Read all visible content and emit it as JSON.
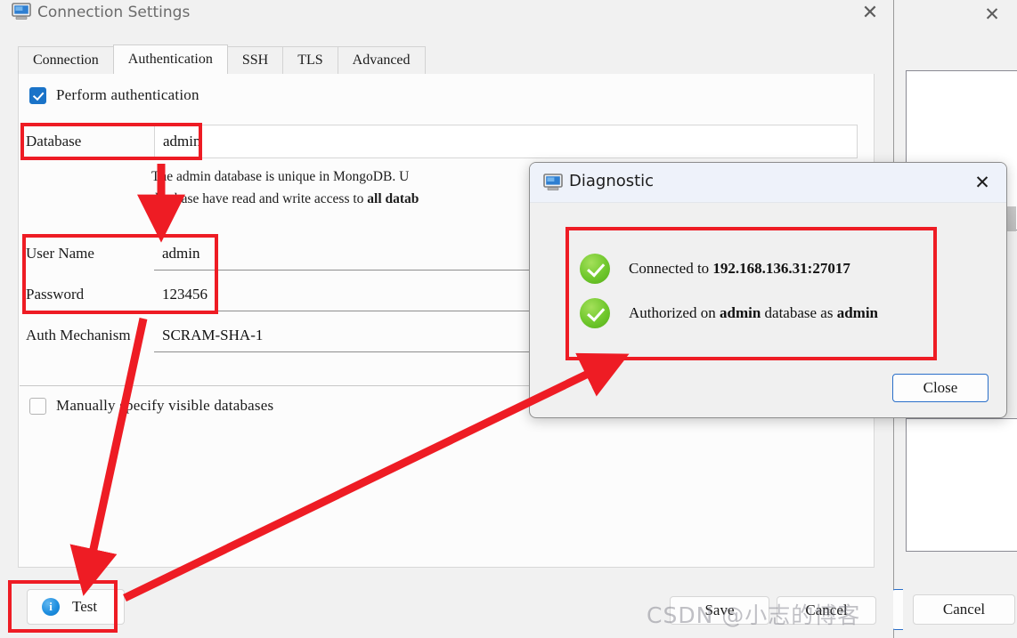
{
  "connection_window": {
    "title": "Connection Settings",
    "title_icon": "monitor-icon",
    "close_label": "✕",
    "tabs": [
      {
        "label": "Connection",
        "active": false
      },
      {
        "label": "Authentication",
        "active": true
      },
      {
        "label": "SSH",
        "active": false
      },
      {
        "label": "TLS",
        "active": false
      },
      {
        "label": "Advanced",
        "active": false
      }
    ],
    "perform_authentication": {
      "label": "Perform authentication",
      "checked": true
    },
    "fields": [
      {
        "label": "Database",
        "value": "admin"
      },
      {
        "label": "User Name",
        "value": "admin"
      },
      {
        "label": "Password",
        "value": "123456"
      },
      {
        "label": "Auth Mechanism",
        "value": "SCRAM-SHA-1"
      }
    ],
    "hint_line1": "The admin database is unique in MongoDB. U",
    "hint_line2_a": "database have read and write access to ",
    "hint_line2_b": "all datab",
    "manually_specify": {
      "label": "Manually specify visible databases",
      "checked": false
    },
    "buttons": {
      "test": "Test",
      "test_icon": "info-icon",
      "save": "Save",
      "cancel": "Cancel"
    }
  },
  "diagnostic_dialog": {
    "title": "Diagnostic",
    "title_icon": "monitor-icon",
    "close_label": "✕",
    "results": [
      {
        "icon": "success-check-icon",
        "prefix": "Connected to ",
        "strong": "192.168.136.31:27017",
        "suffix": ""
      },
      {
        "icon": "success-check-icon",
        "prefix": "Authorized on ",
        "strong": "admin",
        "middle": " database as ",
        "strong2": "admin"
      }
    ],
    "close_button": "Close"
  },
  "background_window": {
    "close_label": "✕",
    "cancel": "Cancel"
  },
  "watermark": "CSDN @小志的博客",
  "colors": {
    "annotation_red": "#ee1c24",
    "accent_blue": "#1a73c8",
    "success_green": "#6fc72c",
    "window_bg": "#f1f1f1",
    "panel_bg": "#fcfcfc"
  }
}
